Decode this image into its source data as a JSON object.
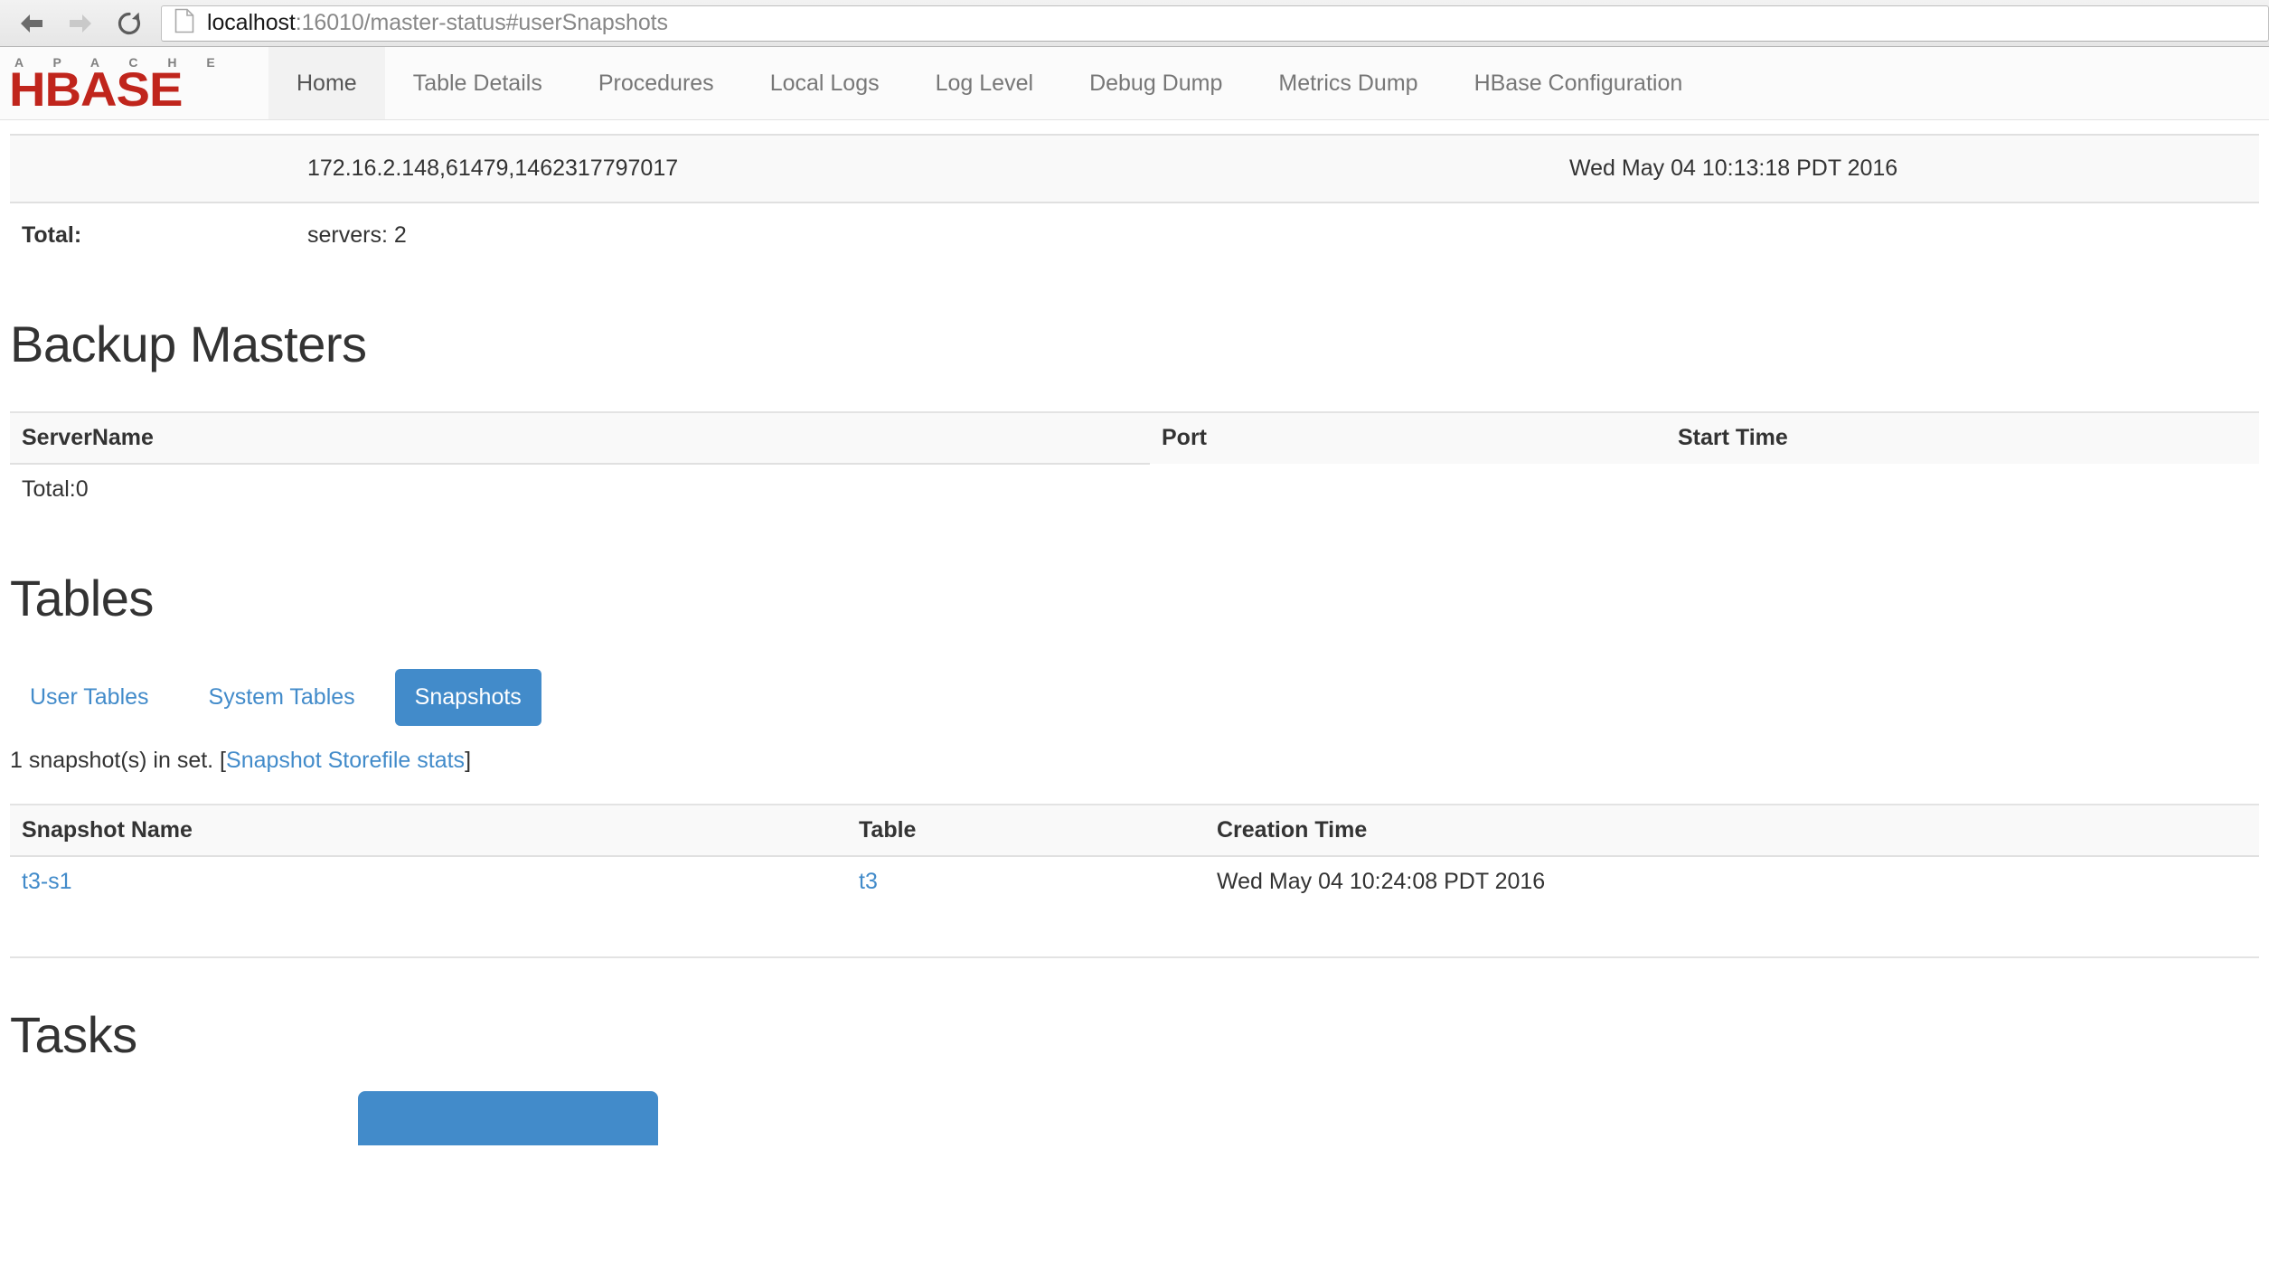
{
  "browser": {
    "back_icon": "back-arrow-icon",
    "forward_icon": "forward-arrow-icon",
    "reload_icon": "reload-icon",
    "page_icon": "page-document-icon",
    "url_host": "localhost",
    "url_rest": ":16010/master-status#userSnapshots"
  },
  "navbar": {
    "brand": {
      "apache": "A P A C H E",
      "hbase": "HBASE",
      "color": "#c0251c"
    },
    "items": [
      {
        "label": "Home",
        "active": true
      },
      {
        "label": "Table Details",
        "active": false
      },
      {
        "label": "Procedures",
        "active": false
      },
      {
        "label": "Local Logs",
        "active": false
      },
      {
        "label": "Log Level",
        "active": false
      },
      {
        "label": "Debug Dump",
        "active": false
      },
      {
        "label": "Metrics Dump",
        "active": false
      },
      {
        "label": "HBase Configuration",
        "active": false
      }
    ]
  },
  "region_servers": {
    "server_name": "172.16.2.148,61479,1462317797017",
    "start_time": "Wed May 04 10:13:18 PDT 2016",
    "total_label": "Total:",
    "total_value": "servers: 2"
  },
  "backup_masters": {
    "heading": "Backup Masters",
    "columns": [
      "ServerName",
      "Port",
      "Start Time"
    ],
    "total": "Total:0"
  },
  "tables_section": {
    "heading": "Tables",
    "tabs": [
      {
        "label": "User Tables",
        "active": false
      },
      {
        "label": "System Tables",
        "active": false
      },
      {
        "label": "Snapshots",
        "active": true
      }
    ],
    "count_prefix": "1 snapshot(s) in set. [",
    "count_link": "Snapshot Storefile stats",
    "count_suffix": "]",
    "columns": [
      "Snapshot Name",
      "Table",
      "Creation Time"
    ],
    "rows": [
      {
        "snapshot_name": "t3-s1",
        "table": "t3",
        "creation_time": "Wed May 04 10:24:08 PDT 2016"
      }
    ]
  },
  "tasks_section": {
    "heading": "Tasks"
  },
  "colors": {
    "accent_blue": "#428bca",
    "brand_red": "#c0251c",
    "table_head_bg": "#f9f9f9"
  }
}
